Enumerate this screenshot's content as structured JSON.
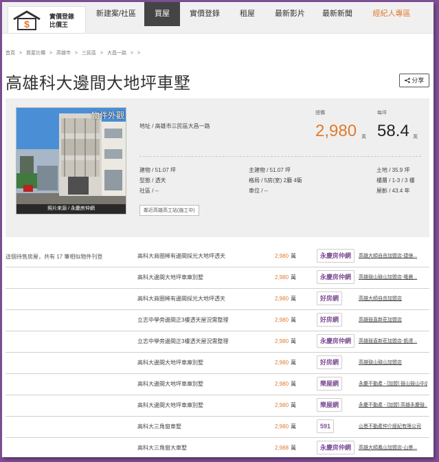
{
  "logo": {
    "line1": "實價登錄",
    "line2": "比價王",
    "icon": "house-dollar-icon"
  },
  "nav": [
    {
      "label": "新建案/社區",
      "active": false,
      "agent": false
    },
    {
      "label": "買屋",
      "active": true,
      "agent": false
    },
    {
      "label": "實價登錄",
      "active": false,
      "agent": false
    },
    {
      "label": "租屋",
      "active": false,
      "agent": false
    },
    {
      "label": "最新影片",
      "active": false,
      "agent": false
    },
    {
      "label": "最新新聞",
      "active": false,
      "agent": false
    },
    {
      "label": "經紀人專區",
      "active": false,
      "agent": true
    }
  ],
  "breadcrumb": [
    "首頁",
    ">",
    "買屋比價",
    ">",
    "高雄市",
    ">",
    "三民區",
    ">",
    "大昌一路",
    ">",
    ">"
  ],
  "title": "高雄科大邊間大地坪車墅",
  "share_label": "分享",
  "photo": {
    "tag": "物件外觀",
    "caption": "照片來源 / 永慶房仲網"
  },
  "address": "地址 / 高雄市三民區大昌一路",
  "price": {
    "label": "總價",
    "value": "2,980",
    "unit": "萬"
  },
  "unit_price": {
    "label": "每坪",
    "value": "58.4",
    "unit": "萬"
  },
  "details": {
    "building": "建物 / 51.07 坪",
    "main_building": "主建物 / 51.07 坪",
    "land": "土地 / 35.9 坪",
    "type": "型態 / 透天",
    "layout": "格局 / 5房(室) 2廳 4衛",
    "floor": "樓層 / 1-3 / 3 樓",
    "community": "社區 / --",
    "parking": "車位 / --",
    "age": "屋齡 / 43.4 年"
  },
  "mrt": "鄰近高雄高工站(施工中)",
  "similar_note": "這個待售房屋，共有 17 筆相似物件刊登",
  "listings": [
    {
      "name": "高科大商圈稀有邊間採光大地坪透天",
      "price": "2,980",
      "unit": "萬",
      "brand": "永慶房仲網",
      "store": "高雄大順自由加盟店-捷億..."
    },
    {
      "name": "高科大邊間大地坪車庫別墅",
      "price": "2,980",
      "unit": "萬",
      "brand": "永慶房仲網",
      "store": "高雄鼓山鼓山加盟店-隆晨..."
    },
    {
      "name": "高科大商圈稀有邊間採光大地坪透天",
      "price": "2,980",
      "unit": "萬",
      "brand": "好房網",
      "store": "高雄大順自由加盟店"
    },
    {
      "name": "立志中學旁邊間正3樓透天屋況需整理",
      "price": "2,980",
      "unit": "萬",
      "brand": "好房網",
      "store": "高雄鼓直新莊加盟店"
    },
    {
      "name": "立志中學旁邊間正3樓透天屋況需整理",
      "price": "2,980",
      "unit": "萬",
      "brand": "永慶房仲網",
      "store": "高雄鼓直新莊加盟店-凱達..."
    },
    {
      "name": "高科大邊間大地坪車庫別墅",
      "price": "2,980",
      "unit": "萬",
      "brand": "好房網",
      "store": "高雄鼓山鼓山加盟店"
    },
    {
      "name": "高科大邊間大地坪車庫別墅",
      "price": "2,980",
      "unit": "萬",
      "brand": "樂屋網",
      "store": "永慶不動產 - [加盟] 鼓山鼓山中店"
    },
    {
      "name": "高科大邊間大地坪車庫別墅",
      "price": "2,980",
      "unit": "萬",
      "brand": "樂屋網",
      "store": "永慶不動產 - [加盟] 高雄永慶鼓..."
    },
    {
      "name": "高科大三角窗車墅",
      "price": "2,980",
      "unit": "萬",
      "brand": "591",
      "store": "山景不動產仲介經紀有限公司"
    },
    {
      "name": "高科大三角窗大車墅",
      "price": "2,988",
      "unit": "萬",
      "brand": "永慶房仲網",
      "store": "高雄大順鳳山加盟店-山景..."
    }
  ],
  "colors": {
    "frame": "#7e4f96",
    "accent": "#e07a2e",
    "nav_active": "#444444"
  }
}
